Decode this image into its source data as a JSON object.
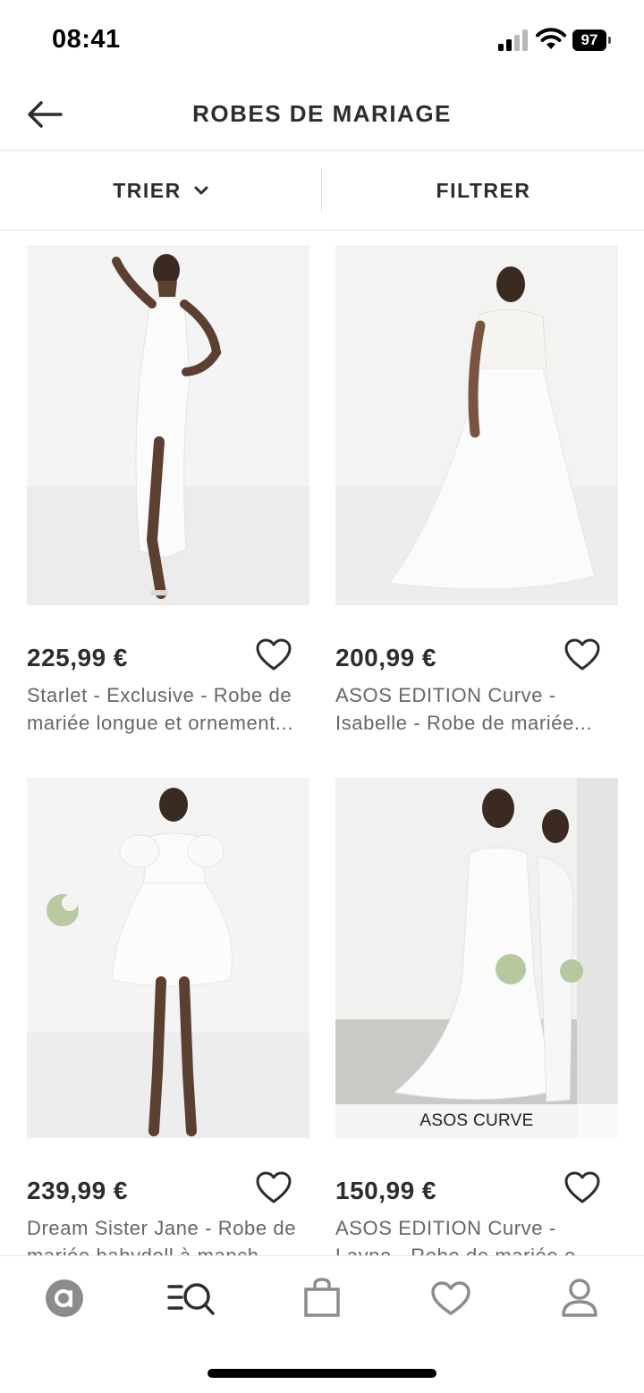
{
  "status_bar": {
    "time": "08:41",
    "battery": "97"
  },
  "header": {
    "title": "ROBES DE MARIAGE"
  },
  "toolbar": {
    "sort_label": "TRIER",
    "filter_label": "FILTRER"
  },
  "products": [
    {
      "price": "225,99 €",
      "name_line1": "Starlet - Exclusive - Robe de",
      "name_line2": "mariée longue et ornement...",
      "tag": ""
    },
    {
      "price": "200,99 €",
      "name_line1": "ASOS EDITION Curve -",
      "name_line2": "Isabelle - Robe de mariée...",
      "tag": ""
    },
    {
      "price": "239,99 €",
      "name_line1": "Dream Sister Jane - Robe de",
      "name_line2": "mariée babydoll à manch...",
      "tag": ""
    },
    {
      "price": "150,99 €",
      "name_line1": "ASOS EDITION Curve -",
      "name_line2": "Layne - Robe de mariée e...",
      "tag": "ASOS CURVE"
    }
  ],
  "bottom_nav": [
    {
      "icon": "asos-home-icon"
    },
    {
      "icon": "search-categories-icon"
    },
    {
      "icon": "shopping-bag-icon"
    },
    {
      "icon": "saved-items-heart-icon"
    },
    {
      "icon": "account-icon"
    }
  ],
  "colors": {
    "text": "#2d2d2d",
    "muted": "#666666",
    "divider": "#e6e6e6",
    "icon_gray": "#8c8c8c"
  }
}
